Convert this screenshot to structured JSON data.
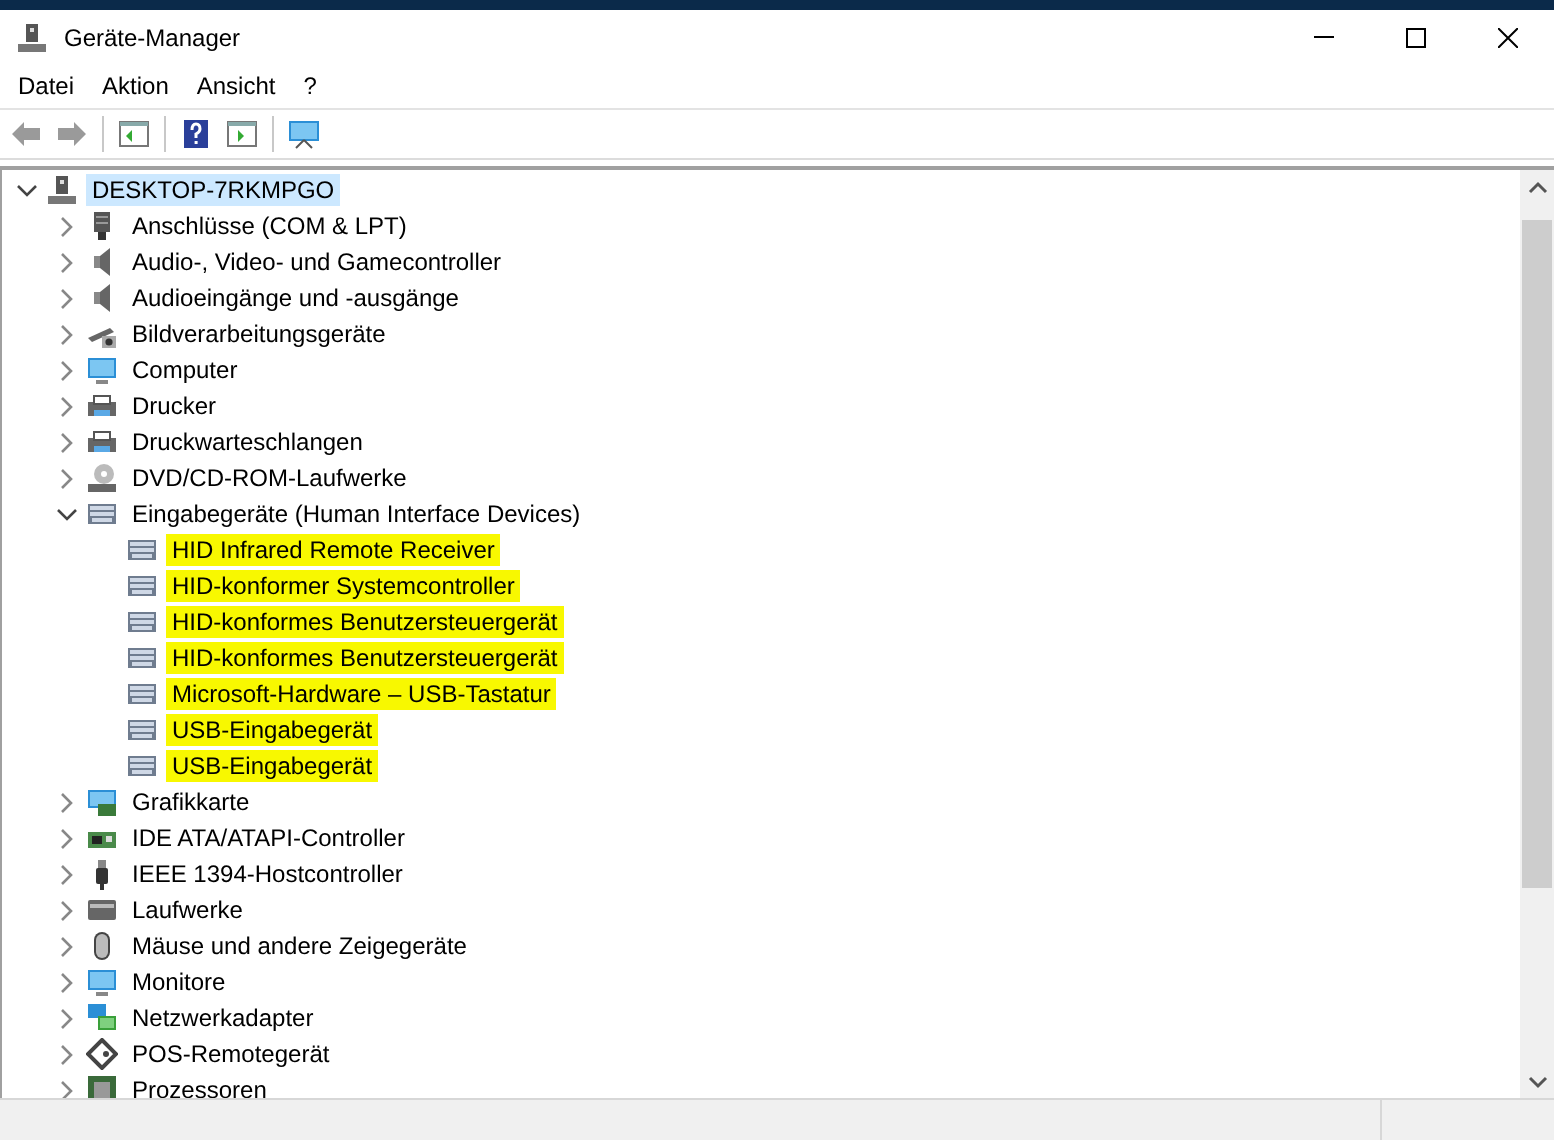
{
  "window": {
    "title": "Geräte-Manager"
  },
  "menu": [
    "Datei",
    "Aktion",
    "Ansicht",
    "?"
  ],
  "tree": {
    "label": "DESKTOP-7RKMPGO",
    "selected": true,
    "expanded": true,
    "children": [
      {
        "label": "Anschlüsse (COM & LPT)",
        "expanded": false
      },
      {
        "label": "Audio-, Video- und Gamecontroller",
        "expanded": false
      },
      {
        "label": "Audioeingänge und -ausgänge",
        "expanded": false
      },
      {
        "label": "Bildverarbeitungsgeräte",
        "expanded": false
      },
      {
        "label": "Computer",
        "expanded": false
      },
      {
        "label": "Drucker",
        "expanded": false
      },
      {
        "label": "Druckwarteschlangen",
        "expanded": false
      },
      {
        "label": "DVD/CD-ROM-Laufwerke",
        "expanded": false
      },
      {
        "label": "Eingabegeräte (Human Interface Devices)",
        "expanded": true,
        "children": [
          {
            "label": "HID Infrared Remote Receiver",
            "highlighted": true
          },
          {
            "label": "HID-konformer Systemcontroller",
            "highlighted": true
          },
          {
            "label": "HID-konformes Benutzersteuergerät",
            "highlighted": true
          },
          {
            "label": "HID-konformes Benutzersteuergerät",
            "highlighted": true
          },
          {
            "label": "Microsoft-Hardware – USB-Tastatur",
            "highlighted": true
          },
          {
            "label": "USB-Eingabegerät",
            "highlighted": true
          },
          {
            "label": "USB-Eingabegerät",
            "highlighted": true
          }
        ]
      },
      {
        "label": "Grafikkarte",
        "expanded": false
      },
      {
        "label": "IDE ATA/ATAPI-Controller",
        "expanded": false
      },
      {
        "label": "IEEE 1394-Hostcontroller",
        "expanded": false
      },
      {
        "label": "Laufwerke",
        "expanded": false
      },
      {
        "label": "Mäuse und andere Zeigegeräte",
        "expanded": false
      },
      {
        "label": "Monitore",
        "expanded": false
      },
      {
        "label": "Netzwerkadapter",
        "expanded": false
      },
      {
        "label": "POS-Remotegerät",
        "expanded": false
      },
      {
        "label": "Prozessoren",
        "expanded": false
      }
    ]
  }
}
